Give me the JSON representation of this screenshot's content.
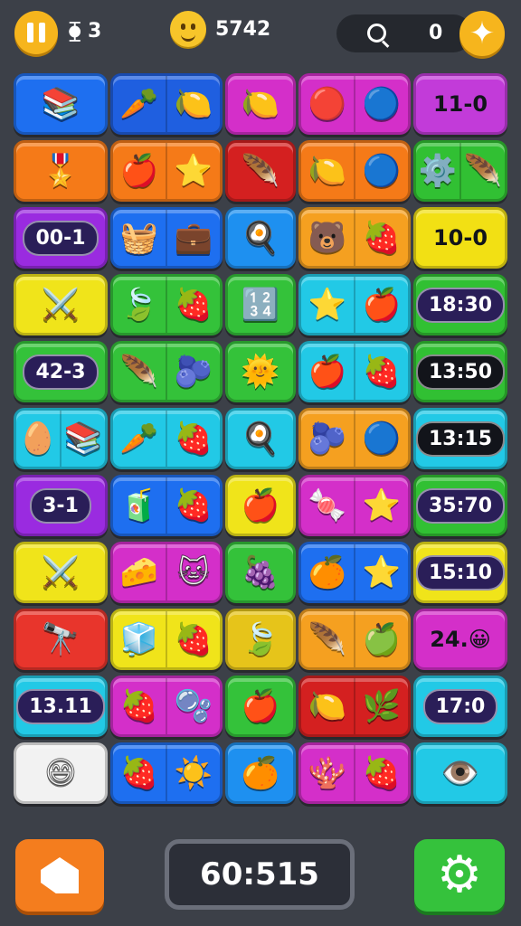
{
  "top_bar": {
    "level_label": "⧳ 3",
    "score_label": "5742",
    "search_count": "0",
    "pause_icon": "pause-icon",
    "smiley_icon": "smiley-icon",
    "search_icon": "search-icon",
    "star_icon": "star-icon"
  },
  "grid": {
    "rows": [
      [
        {
          "bg": "#1e6ff0",
          "items": [
            "📚"
          ]
        },
        {
          "bg": "#1f5fe0",
          "items": [
            "🥕",
            "🍋"
          ]
        },
        {
          "bg": "#d42fc9",
          "items": [
            "🍋"
          ]
        },
        {
          "bg": "#d42fc9",
          "items": [
            "🔴",
            "🔵"
          ]
        },
        {
          "bg": "#c23bd9",
          "text": "11-0"
        }
      ],
      [
        {
          "bg": "#f57a18",
          "items": [
            "🎖️"
          ]
        },
        {
          "bg": "#f57a18",
          "items": [
            "🍎",
            "⭐"
          ]
        },
        {
          "bg": "#d42020",
          "items": [
            "🪶"
          ]
        },
        {
          "bg": "#f57a18",
          "items": [
            "🍋",
            "🔵"
          ]
        },
        {
          "bg": "#31c033",
          "items": [
            "⚙️",
            "🪶"
          ]
        }
      ],
      [
        {
          "bg": "#9a2be0",
          "pill": "00-1"
        },
        {
          "bg": "#1e6ff0",
          "items": [
            "🧺",
            "💼"
          ]
        },
        {
          "bg": "#1e90f0",
          "items": [
            "🍳"
          ]
        },
        {
          "bg": "#f5a020",
          "items": [
            "🐻",
            "🍓"
          ]
        },
        {
          "bg": "#f2e014",
          "text": "10-0"
        }
      ],
      [
        {
          "bg": "#f0e41a",
          "items": [
            "⚔️"
          ]
        },
        {
          "bg": "#34c23a",
          "items": [
            "🍃",
            "🍓"
          ]
        },
        {
          "bg": "#34c23a",
          "items": [
            "🔢"
          ]
        },
        {
          "bg": "#22c9e6",
          "items": [
            "⭐",
            "🍎"
          ]
        },
        {
          "bg": "#31c033",
          "pill": "18:30"
        }
      ],
      [
        {
          "bg": "#34c23a",
          "pill": "42-3"
        },
        {
          "bg": "#34c23a",
          "items": [
            "🪶",
            "🫐"
          ]
        },
        {
          "bg": "#34c23a",
          "items": [
            "🌞"
          ]
        },
        {
          "bg": "#22c9e6",
          "items": [
            "🍎",
            "🍓"
          ]
        },
        {
          "bg": "#31c033",
          "pill": "13:50",
          "dark": true
        }
      ],
      [
        {
          "bg": "#22c9e6",
          "items": [
            "🥚",
            "📚"
          ]
        },
        {
          "bg": "#22c9e6",
          "items": [
            "🥕",
            "🍓"
          ]
        },
        {
          "bg": "#22c9e6",
          "items": [
            "🍳"
          ]
        },
        {
          "bg": "#f5a020",
          "items": [
            "🫐",
            "🔵"
          ]
        },
        {
          "bg": "#22c9e6",
          "pill": "13:15",
          "dark": true
        }
      ],
      [
        {
          "bg": "#9a2be0",
          "pill": "3-1"
        },
        {
          "bg": "#1e6ff0",
          "items": [
            "🧃",
            "🍓"
          ]
        },
        {
          "bg": "#f0e41a",
          "items": [
            "🍎"
          ]
        },
        {
          "bg": "#d42fc9",
          "items": [
            "🍬",
            "⭐"
          ]
        },
        {
          "bg": "#31c033",
          "pill": "35:70"
        }
      ],
      [
        {
          "bg": "#f0e41a",
          "items": [
            "⚔️"
          ]
        },
        {
          "bg": "#d42fc9",
          "items": [
            "🧀",
            "🐱"
          ]
        },
        {
          "bg": "#34c23a",
          "items": [
            "🍇"
          ]
        },
        {
          "bg": "#1e6ff0",
          "items": [
            "🍊",
            "⭐"
          ]
        },
        {
          "bg": "#f0e41a",
          "pill": "15:10"
        }
      ],
      [
        {
          "bg": "#e8352c",
          "items": [
            "🔭"
          ]
        },
        {
          "bg": "#f0e41a",
          "items": [
            "🧊",
            "🍓"
          ]
        },
        {
          "bg": "#e6c41a",
          "items": [
            "🍃"
          ]
        },
        {
          "bg": "#f5a020",
          "items": [
            "🪶",
            "🍏"
          ]
        },
        {
          "bg": "#d42fc9",
          "text": "24.😀"
        }
      ],
      [
        {
          "bg": "#22c9e6",
          "pill": "13.11"
        },
        {
          "bg": "#d42fc9",
          "items": [
            "🍓",
            "🫧"
          ]
        },
        {
          "bg": "#34c23a",
          "items": [
            "🍎"
          ]
        },
        {
          "bg": "#d42020",
          "items": [
            "🍋",
            "🌿"
          ]
        },
        {
          "bg": "#22c9e6",
          "pill": "17:0"
        }
      ],
      [
        {
          "bg": "#f2f2f2",
          "items": [
            "😄"
          ]
        },
        {
          "bg": "#1e6ff0",
          "items": [
            "🍓",
            "☀️"
          ]
        },
        {
          "bg": "#1e90f0",
          "items": [
            "🍊"
          ]
        },
        {
          "bg": "#d42fc9",
          "items": [
            "🪸",
            "🍓"
          ]
        },
        {
          "bg": "#22c9e6",
          "items": [
            "👁️"
          ]
        }
      ]
    ]
  },
  "bottom_bar": {
    "timer": "60:515",
    "hint_icon": "home-arrow-icon",
    "settings_icon": "gear-icon"
  }
}
